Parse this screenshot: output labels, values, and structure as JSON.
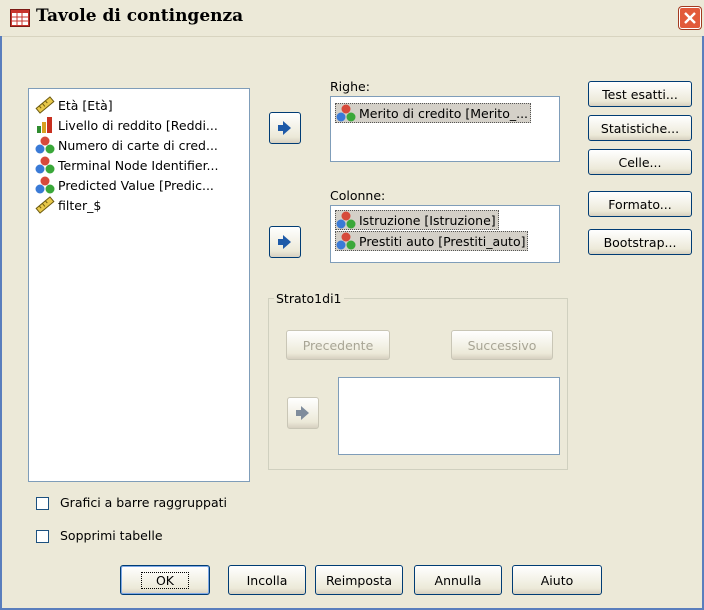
{
  "window": {
    "title": "Tavole di contingenza",
    "app_icon": "table-icon",
    "close_icon": "close-icon"
  },
  "variables": {
    "items": [
      {
        "label": "Età [Età]",
        "icon": "scale-ruler-icon"
      },
      {
        "label": "Livello di reddito [Reddi...",
        "icon": "ordinal-bar-icon"
      },
      {
        "label": "Numero di carte di cred...",
        "icon": "nominal-circles-icon"
      },
      {
        "label": "Terminal Node Identifier...",
        "icon": "nominal-circles-icon"
      },
      {
        "label": "Predicted Value [Predic...",
        "icon": "nominal-circles-icon"
      },
      {
        "label": "filter_$",
        "icon": "scale-ruler-icon"
      }
    ]
  },
  "rows": {
    "label": "Righe:",
    "items": [
      {
        "label": "Merito di credito [Merito_...",
        "icon": "nominal-circles-icon"
      }
    ]
  },
  "columns": {
    "label": "Colonne:",
    "items": [
      {
        "label": "Istruzione [Istruzione]",
        "icon": "nominal-circles-icon"
      },
      {
        "label": "Prestiti auto [Prestiti_auto]",
        "icon": "nominal-circles-icon"
      }
    ]
  },
  "layer": {
    "label": "Strato1di1",
    "prev_label": "Precedente",
    "next_label": "Successivo",
    "items": []
  },
  "side_buttons": {
    "exact": "Test esatti...",
    "statistics": "Statistiche...",
    "cells": "Celle...",
    "format": "Formato...",
    "bootstrap": "Bootstrap..."
  },
  "options": {
    "clustered_bars": {
      "label": "Grafici a barre raggruppati",
      "checked": false
    },
    "suppress_tables": {
      "label": "Sopprimi tabelle",
      "checked": false
    }
  },
  "footer": {
    "ok": "OK",
    "paste": "Incolla",
    "reset": "Reimposta",
    "cancel": "Annulla",
    "help": "Aiuto"
  },
  "colors": {
    "accent": "#003c74",
    "frame": "#5a7ebd",
    "close": "#e25a3a",
    "arrow_active": "#1e5aa8"
  }
}
